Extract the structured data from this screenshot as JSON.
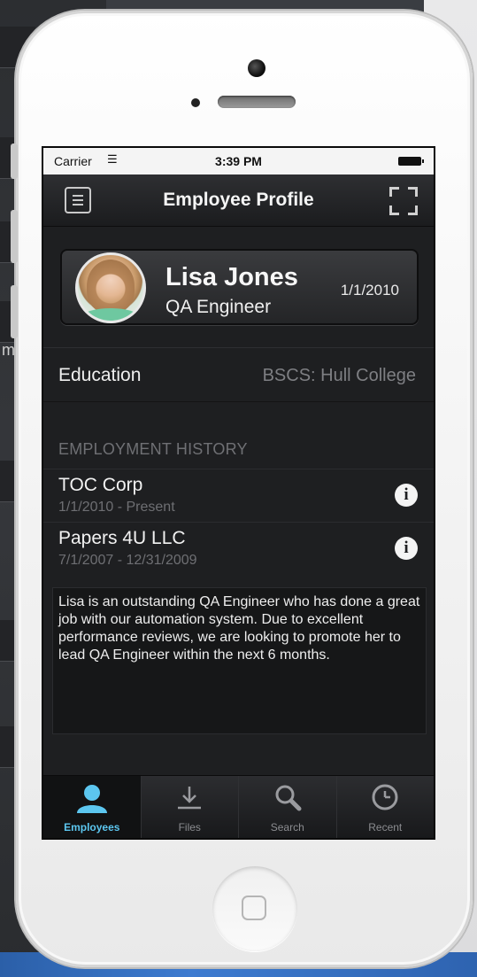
{
  "status_bar": {
    "carrier": "Carrier",
    "time": "3:39 PM"
  },
  "nav": {
    "title": "Employee Profile"
  },
  "profile": {
    "name": "Lisa Jones",
    "role": "QA Engineer",
    "date": "1/1/2010"
  },
  "education": {
    "label": "Education",
    "value": "BSCS: Hull College"
  },
  "history": {
    "header": "EMPLOYMENT HISTORY",
    "items": [
      {
        "company": "TOC Corp",
        "dates": "1/1/2010 - Present"
      },
      {
        "company": "Papers 4U LLC",
        "dates": "7/1/2007 - 12/31/2009"
      }
    ]
  },
  "notes": "Lisa is an outstanding QA Engineer who has done a great job with our automation system. Due to excellent performance reviews, we are looking to promote her to lead QA Engineer within the next 6 months.",
  "tabs": [
    {
      "label": "Employees",
      "icon": "person-icon",
      "active": true
    },
    {
      "label": "Files",
      "icon": "download-icon",
      "active": false
    },
    {
      "label": "Search",
      "icon": "search-icon",
      "active": false
    },
    {
      "label": "Recent",
      "icon": "clock-icon",
      "active": false
    }
  ],
  "colors": {
    "active_tab": "#5cc6ef",
    "screen_bg": "#1e1f21"
  }
}
